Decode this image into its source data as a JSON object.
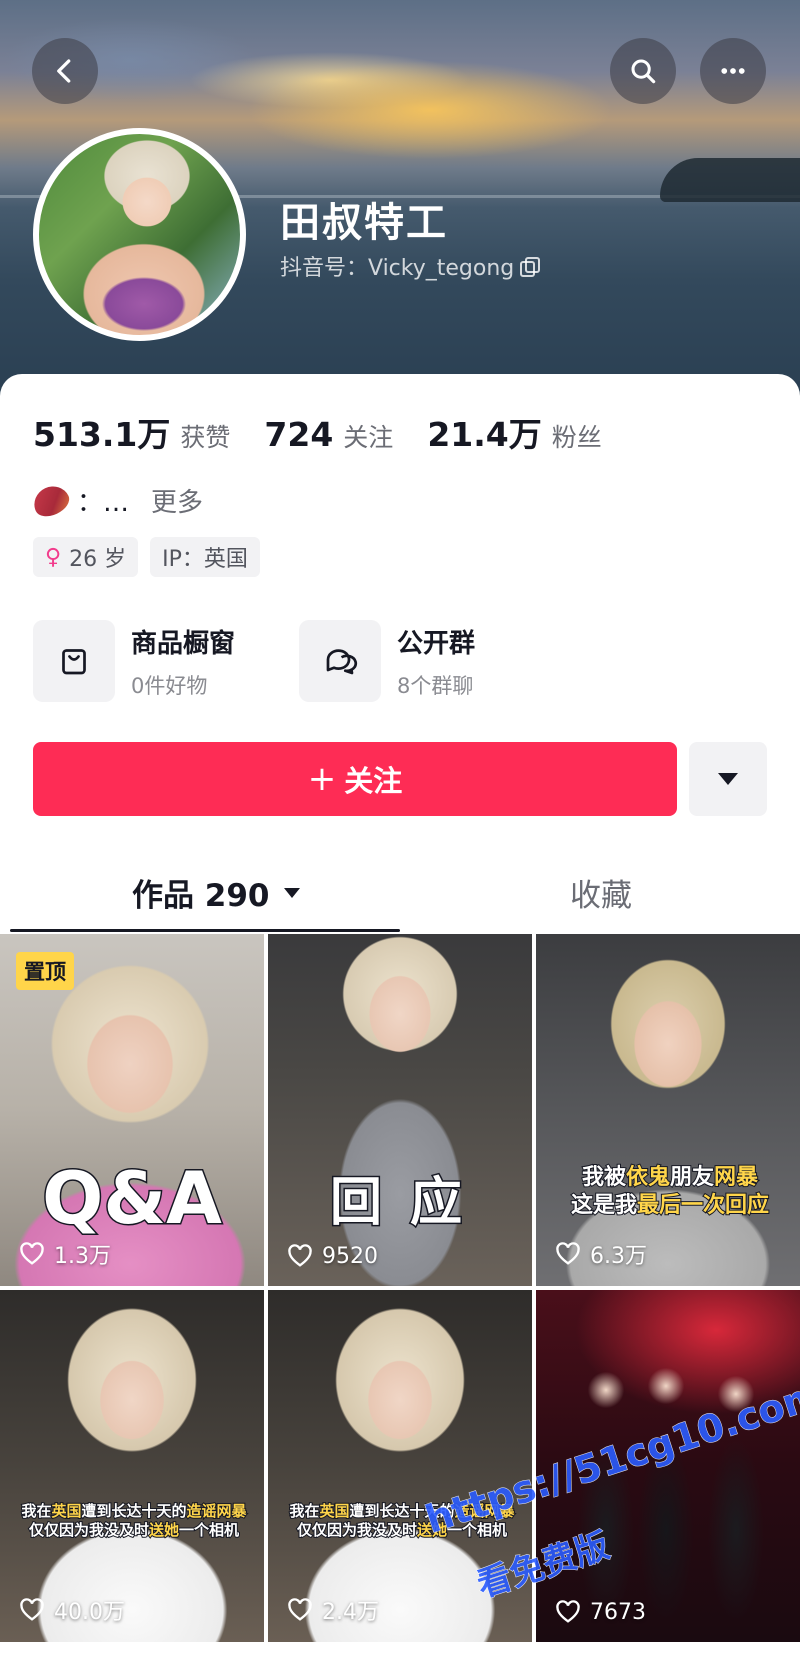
{
  "profile": {
    "name": "田叔特工",
    "douyin_id": "抖音号：Vicky_tegong"
  },
  "stats": [
    {
      "num": "513.1万",
      "label": "获赞"
    },
    {
      "num": "724",
      "label": "关注"
    },
    {
      "num": "21.4万",
      "label": "粉丝"
    }
  ],
  "bio": {
    "text": "：…",
    "more": "更多"
  },
  "tags": {
    "age": "26 岁",
    "ip": "IP：英国"
  },
  "entries": [
    {
      "title": "商品橱窗",
      "sub": "0件好物",
      "icon": "shopping-bag-icon"
    },
    {
      "title": "公开群",
      "sub": "8个群聊",
      "icon": "chat-bubbles-icon"
    }
  ],
  "follow": {
    "plus": "+",
    "label": "关注"
  },
  "tabs": {
    "works": "作品 290",
    "favorites": "收藏"
  },
  "videos": [
    {
      "likes": "1.3万",
      "pinned": "置顶",
      "caption": "Q&A"
    },
    {
      "likes": "9520",
      "caption": "回应"
    },
    {
      "likes": "6.3万",
      "caption_lines": [
        [
          {
            "t": "我被"
          },
          {
            "t": "依鬼",
            "h": "y"
          },
          {
            "t": "朋友"
          },
          {
            "t": "网暴",
            "h": "y"
          }
        ],
        [
          {
            "t": "这是我"
          },
          {
            "t": "最后一次回应",
            "h": "y"
          }
        ]
      ]
    },
    {
      "likes": "40.0万",
      "caption_lines": [
        [
          {
            "t": "我在"
          },
          {
            "t": "英国",
            "h": "y"
          },
          {
            "t": "遭到长达十天的"
          },
          {
            "t": "造谣网暴",
            "h": "y"
          }
        ],
        [
          {
            "t": "仅仅因为我没及时"
          },
          {
            "t": "送她",
            "h": "y"
          },
          {
            "t": "一个相机"
          }
        ]
      ]
    },
    {
      "likes": "2.4万",
      "caption_lines": [
        [
          {
            "t": "我在"
          },
          {
            "t": "英国",
            "h": "y"
          },
          {
            "t": "遭到长达十天的"
          },
          {
            "t": "造谣网暴",
            "h": "y"
          }
        ],
        [
          {
            "t": "仅仅因为我没及时"
          },
          {
            "t": "送她",
            "h": "y"
          },
          {
            "t": "一个相机"
          }
        ]
      ]
    },
    {
      "likes": "7673"
    }
  ],
  "watermark": {
    "url": "https://51cg10.com",
    "sub": "看免费版"
  },
  "colors": {
    "accent": "#fe2c55",
    "pin": "#ffd54a",
    "female": "#f23c8c"
  }
}
